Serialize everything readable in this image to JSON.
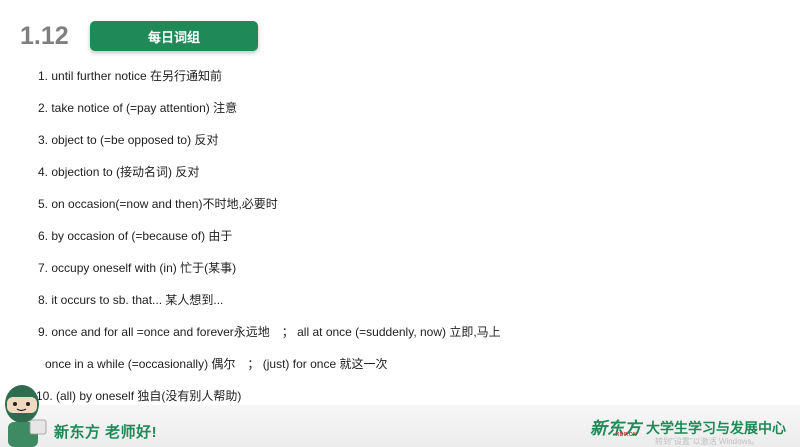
{
  "header": {
    "date": "1.12",
    "title_button": "每日词组"
  },
  "phrases": [
    "1. until further notice 在另行通知前",
    "2. take notice of (=pay attention) 注意",
    "3. object to (=be opposed to) 反对",
    "4. objection to (接动名词) 反对",
    "5. on occasion(=now and then)不时地,必要时",
    "6. by occasion of (=because of) 由于",
    "7. occupy oneself with (in) 忙于(某事)",
    "8. it occurs to sb. that... 某人想到...",
    "9. once and for all =once and forever永远地　；  all at once (=suddenly, now) 立即,马上",
    "once in a while (=occasionally) 偶尔　；  (just) for once 就这一次",
    "10. (all) by oneself 独自(没有别人帮助)"
  ],
  "footer": {
    "slogan": "新东方 老师好!",
    "logo_text": "新东方",
    "logo_sub": "XDF.CN",
    "center_name": "大学生学习与发展中心",
    "watermark": "转到\"设置\"以激活 Windows。"
  },
  "colors": {
    "accent": "#1f8a57",
    "date_gray": "#7f7f7f",
    "text": "#1e1e1e"
  }
}
